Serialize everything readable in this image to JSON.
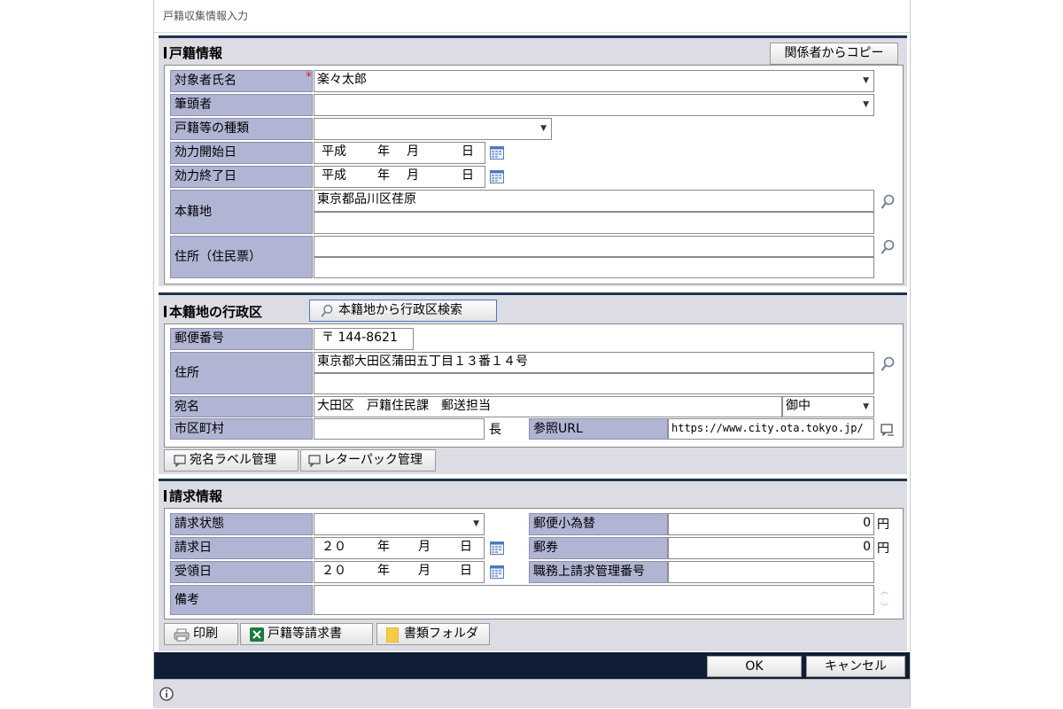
{
  "window_title": "戸籍収集情報入力",
  "koseki": {
    "title": "戸籍情報",
    "copy_button": "関係者からコピー",
    "subject_name_label": "対象者氏名",
    "required_mark": "*",
    "subject_name_value": "楽々太郎",
    "head_label": "筆頭者",
    "head_value": "",
    "type_label": "戸籍等の種類",
    "type_value": "",
    "start_label": "効力開始日",
    "end_label": "効力終了日",
    "era": "平成",
    "year_unit": "年",
    "month_unit": "月",
    "day_unit": "日",
    "honseki_label": "本籍地",
    "honseki_value": "東京都品川区荏原",
    "address_label": "住所（住民票）",
    "address_value": ""
  },
  "gyosei": {
    "title": "本籍地の行政区",
    "search_button": "本籍地から行政区検索",
    "postal_label": "郵便番号",
    "postal_value": "〒 144-8621",
    "address_label": "住所",
    "address_value": "東京都大田区蒲田五丁目１３番１４号",
    "atena_label": "宛名",
    "atena_value": "大田区　戸籍住民課　郵送担当",
    "honorific": "御中",
    "city_label": "市区町村",
    "city_value": "",
    "cho": "長",
    "url_label": "参照URL",
    "url_value": "https://www.city.ota.tokyo.jp/",
    "label_button": "宛名ラベル管理",
    "letterpack_button": "レターパック管理"
  },
  "seikyu": {
    "title": "請求情報",
    "status_label": "請求状態",
    "status_value": "",
    "date_label": "請求日",
    "received_label": "受領日",
    "era": "２０",
    "year_unit": "年",
    "month_unit": "月",
    "day_unit": "日",
    "money_order_label": "郵便小為替",
    "money_order_value": "0",
    "stamp_label": "郵券",
    "stamp_value": "0",
    "yen": "円",
    "mgmt_label": "職務上請求管理番号",
    "mgmt_value": "",
    "notes_label": "備考",
    "notes_value": "",
    "print_button": "印刷",
    "request_button": "戸籍等請求書",
    "folder_button": "書類フォルダ"
  },
  "footer": {
    "ok": "OK",
    "cancel": "キャンセル"
  },
  "colors": {
    "label_bg": "#b1b5d4",
    "section_bg": "#dcdde4",
    "footer_bg": "#0f1e34",
    "excel_green": "#1d7a3e",
    "folder_yellow": "#f4cc4a"
  }
}
